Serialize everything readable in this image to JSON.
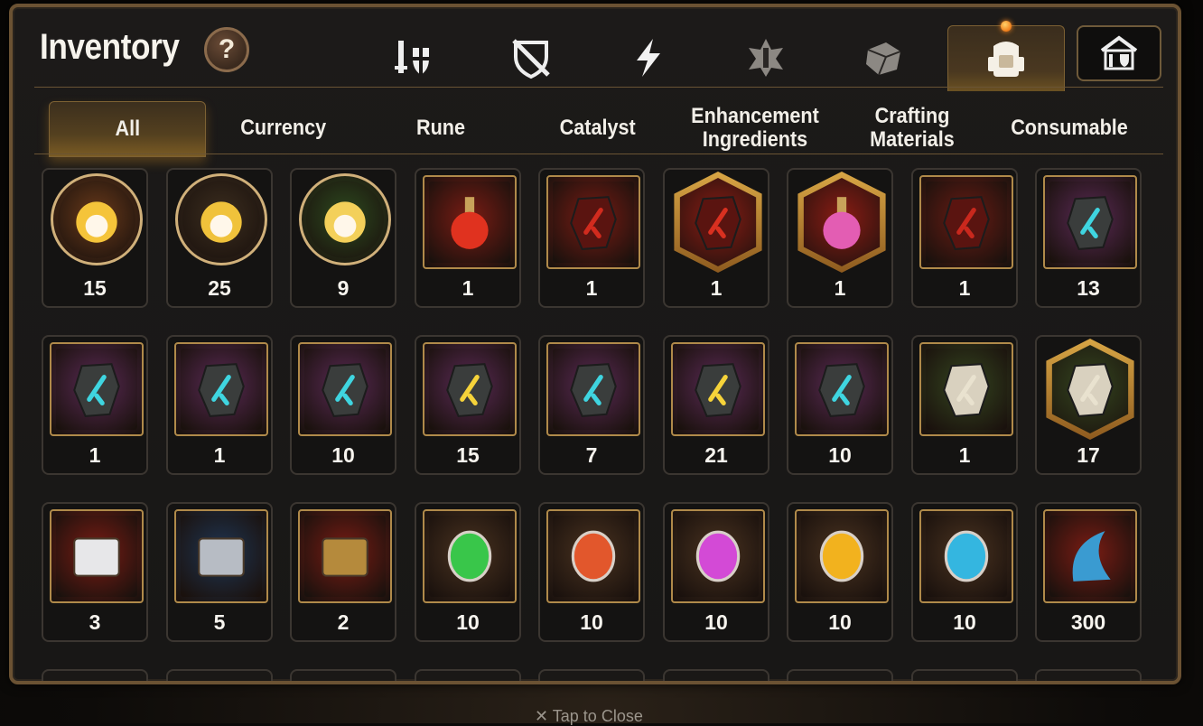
{
  "window": {
    "title": "Inventory",
    "help_label": "?"
  },
  "top_icons": [
    {
      "name": "hero-gear-icon",
      "active": false
    },
    {
      "name": "broken-shield-icon",
      "active": false
    },
    {
      "name": "lightning-icon",
      "active": false
    },
    {
      "name": "artifact-icon",
      "active": false
    },
    {
      "name": "dice-icon",
      "active": false
    },
    {
      "name": "backpack-icon",
      "active": true
    },
    {
      "name": "guild-storage-icon",
      "active": false
    }
  ],
  "tabs": [
    {
      "label": "All",
      "active": true
    },
    {
      "label": "Currency",
      "active": false
    },
    {
      "label": "Rune",
      "active": false
    },
    {
      "label": "Catalyst",
      "active": false
    },
    {
      "label": "Enhancement Ingredients",
      "active": false
    },
    {
      "label": "Crafting Materials",
      "active": false
    },
    {
      "label": "Consumable",
      "active": false
    }
  ],
  "items": [
    {
      "name": "golden-mola-coin",
      "count": "15",
      "shape": "circle",
      "bg": "#6a3a1a",
      "icon": "#f5c43a"
    },
    {
      "name": "mola-coin-brown",
      "count": "25",
      "shape": "circle",
      "bg": "#3c2e1f",
      "icon": "#f0c23b"
    },
    {
      "name": "mola-coin-green",
      "count": "9",
      "shape": "circle",
      "bg": "#2d4a1f",
      "icon": "#f3d05a"
    },
    {
      "name": "red-potion",
      "count": "1",
      "shape": "square",
      "bg": "#7a1c14",
      "icon": "#e0321f"
    },
    {
      "name": "red-ring-stone",
      "count": "1",
      "shape": "square",
      "bg": "#7a1c14",
      "icon": "#d12b1e"
    },
    {
      "name": "red-star-stone",
      "count": "1",
      "shape": "hex",
      "bg": "#8a1c14",
      "icon": "#d93020"
    },
    {
      "name": "pink-potion",
      "count": "1",
      "shape": "hex",
      "bg": "#8a1c14",
      "icon": "#e35db3"
    },
    {
      "name": "red-necklace-stone",
      "count": "1",
      "shape": "square",
      "bg": "#6a1c14",
      "icon": "#c9281d"
    },
    {
      "name": "blue-sword-stone",
      "count": "13",
      "shape": "square",
      "bg": "#5a2a55",
      "icon": "#3fd5e0"
    },
    {
      "name": "blue-necklace-stone",
      "count": "1",
      "shape": "square",
      "bg": "#5a2a55",
      "icon": "#3fd5e0"
    },
    {
      "name": "blue-ring-stone",
      "count": "1",
      "shape": "square",
      "bg": "#5a2a55",
      "icon": "#3fd5e0"
    },
    {
      "name": "blue-armor-stone",
      "count": "10",
      "shape": "square",
      "bg": "#5a2a55",
      "icon": "#3fd5e0"
    },
    {
      "name": "yellow-weapon-stone",
      "count": "15",
      "shape": "square",
      "bg": "#5a2a55",
      "icon": "#f5d33a"
    },
    {
      "name": "blue-boots-stone",
      "count": "7",
      "shape": "square",
      "bg": "#5a2a55",
      "icon": "#3fd5e0"
    },
    {
      "name": "yellow-hammer-stone",
      "count": "21",
      "shape": "square",
      "bg": "#5a2a55",
      "icon": "#f5d33a"
    },
    {
      "name": "blue-spiral-stone",
      "count": "10",
      "shape": "square",
      "bg": "#5a2a55",
      "icon": "#3fd5e0"
    },
    {
      "name": "white-sword-stone",
      "count": "1",
      "shape": "square",
      "bg": "#34451f",
      "icon": "#e9e2cf"
    },
    {
      "name": "white-star-stone",
      "count": "17",
      "shape": "hex",
      "bg": "#34451f",
      "icon": "#e9e2cf"
    },
    {
      "name": "silver-chest",
      "count": "3",
      "shape": "square",
      "bg": "#7a1c14",
      "icon": "#e7e7e9"
    },
    {
      "name": "iron-chest",
      "count": "5",
      "shape": "square",
      "bg": "#1f3552",
      "icon": "#b7bcc4"
    },
    {
      "name": "golden-chest",
      "count": "2",
      "shape": "square",
      "bg": "#7a1c14",
      "icon": "#b58a3c"
    },
    {
      "name": "green-catalyst",
      "count": "10",
      "shape": "square",
      "bg": "#4a3320",
      "icon": "#39c64a"
    },
    {
      "name": "orange-catalyst",
      "count": "10",
      "shape": "square",
      "bg": "#4a3320",
      "icon": "#e2572c"
    },
    {
      "name": "purple-catalyst",
      "count": "10",
      "shape": "square",
      "bg": "#4a3320",
      "icon": "#d34ad6"
    },
    {
      "name": "yellow-catalyst",
      "count": "10",
      "shape": "square",
      "bg": "#4a3320",
      "icon": "#f2b21e"
    },
    {
      "name": "cyan-catalyst",
      "count": "10",
      "shape": "square",
      "bg": "#4a3320",
      "icon": "#34b6e0"
    },
    {
      "name": "blue-scale-claw",
      "count": "300",
      "shape": "square",
      "bg": "#7a1c14",
      "icon": "#3a9bd1"
    }
  ],
  "footer": {
    "close_label": "Tap to Close",
    "close_icon": "x-icon"
  }
}
